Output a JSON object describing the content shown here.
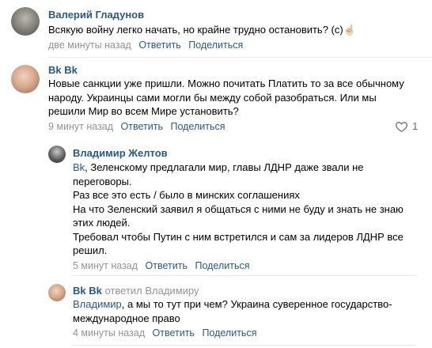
{
  "comments": [
    {
      "author": "Валерий Гладунов",
      "lines": [
        "Всякую войну легко начать, но крайне трудно остановить? (с)☝🏻"
      ],
      "time": "две минуты назад",
      "reply_label": "Ответить",
      "share_label": "Поделиться"
    },
    {
      "author": "Bk Bk",
      "lines": [
        "Новые санкции уже пришли. Можно почитать Платить то за все обычному",
        "народу. Украинцы сами могли бы между собой разобраться. Или мы",
        "решили Мир во всем Мире установить?"
      ],
      "time": "9 минут назад",
      "reply_label": "Ответить",
      "share_label": "Поделиться",
      "like_count": "1",
      "like_icon": "heart-outline-icon"
    },
    {
      "author": "Владимир Желтов",
      "mention": "Bk",
      "lines": [
        ", Зеленскому предлагали мир, главы ЛДНР даже звали не",
        "переговоры.",
        "Раз все это есть / было в минских соглашениях",
        "На что Зеленский заявил я общаться с ними не буду и знать не знаю",
        "этих людей.",
        "Требовал чтобы Путин с ним встретился и сам за лидеров ЛДНР все",
        "решил."
      ],
      "time": "5 минут назад",
      "reply_label": "Ответить",
      "share_label": "Поделиться"
    },
    {
      "author": "Bk Bk",
      "replied_to": "ответил Владимиру",
      "mention": "Владимир",
      "lines": [
        ", а мы то тут при чем? Украина суверенное государство-",
        "международное право"
      ],
      "time": "4 минуты назад",
      "reply_label": "Ответить",
      "share_label": "Поделиться"
    }
  ],
  "colors": {
    "link": "#2a5885",
    "meta": "#939393",
    "divider": "#e7e8ec"
  }
}
